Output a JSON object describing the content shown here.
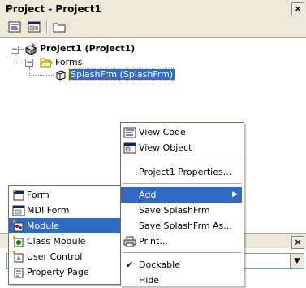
{
  "window": {
    "title": "Project - Project1"
  },
  "tree": {
    "project": {
      "label": "Project1 (Project1)"
    },
    "folder": {
      "label": "Forms"
    },
    "form": {
      "label": "SplashFrm (SplashFrm)"
    }
  },
  "context_menu": {
    "view_code": "View Code",
    "view_object": "View Object",
    "properties": "Project1 Properties...",
    "add": "Add",
    "save": "Save SplashFrm",
    "save_as": "Save SplashFrm As...",
    "print": "Print...",
    "dockable": "Dockable",
    "hide": "Hide"
  },
  "add_submenu": {
    "form": "Form",
    "mdi_form": "MDI Form",
    "module": "Module",
    "class_module": "Class Module",
    "user_control": "User Control",
    "property_page": "Property Page"
  },
  "colors": {
    "selection": "#316ac5",
    "chrome": "#ece9d8"
  }
}
